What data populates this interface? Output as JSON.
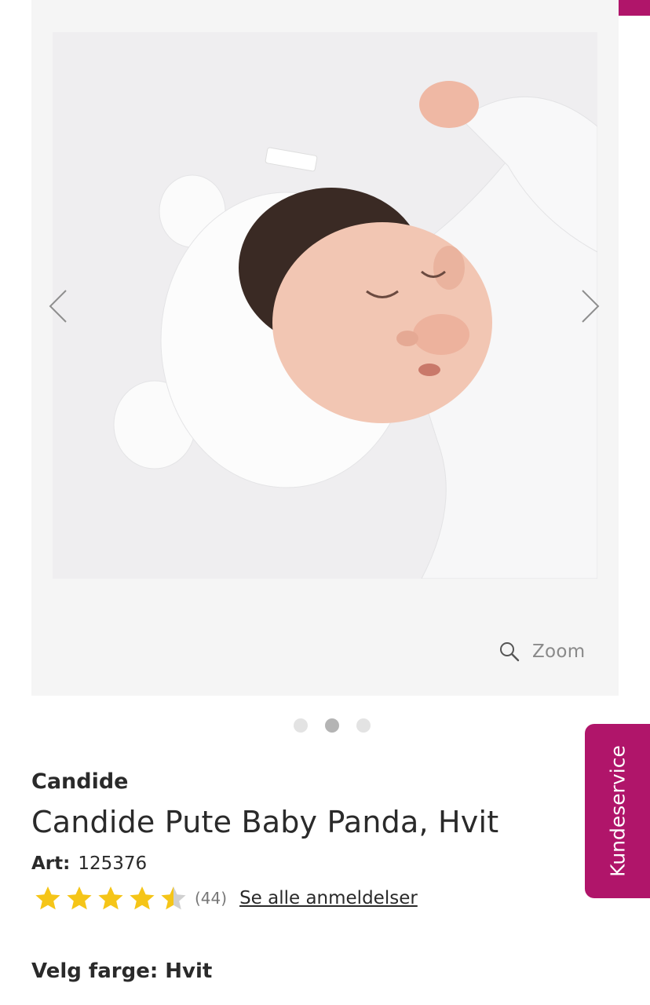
{
  "gallery": {
    "zoom_label": "Zoom",
    "dots": 3,
    "active_dot": 2
  },
  "product": {
    "brand": "Candide",
    "title": "Candide Pute Baby Panda, Hvit",
    "art_label": "Art:",
    "art_number": "125376",
    "rating": 4.5,
    "rating_max": 5,
    "review_count": "(44)",
    "reviews_link": "Se alle anmeldelser",
    "color_select": "Velg farge: Hvit"
  },
  "support": {
    "label": "Kundeservice"
  },
  "colors": {
    "accent": "#b0156a",
    "star": "#f5c518",
    "star_empty": "#d0d0d0"
  }
}
